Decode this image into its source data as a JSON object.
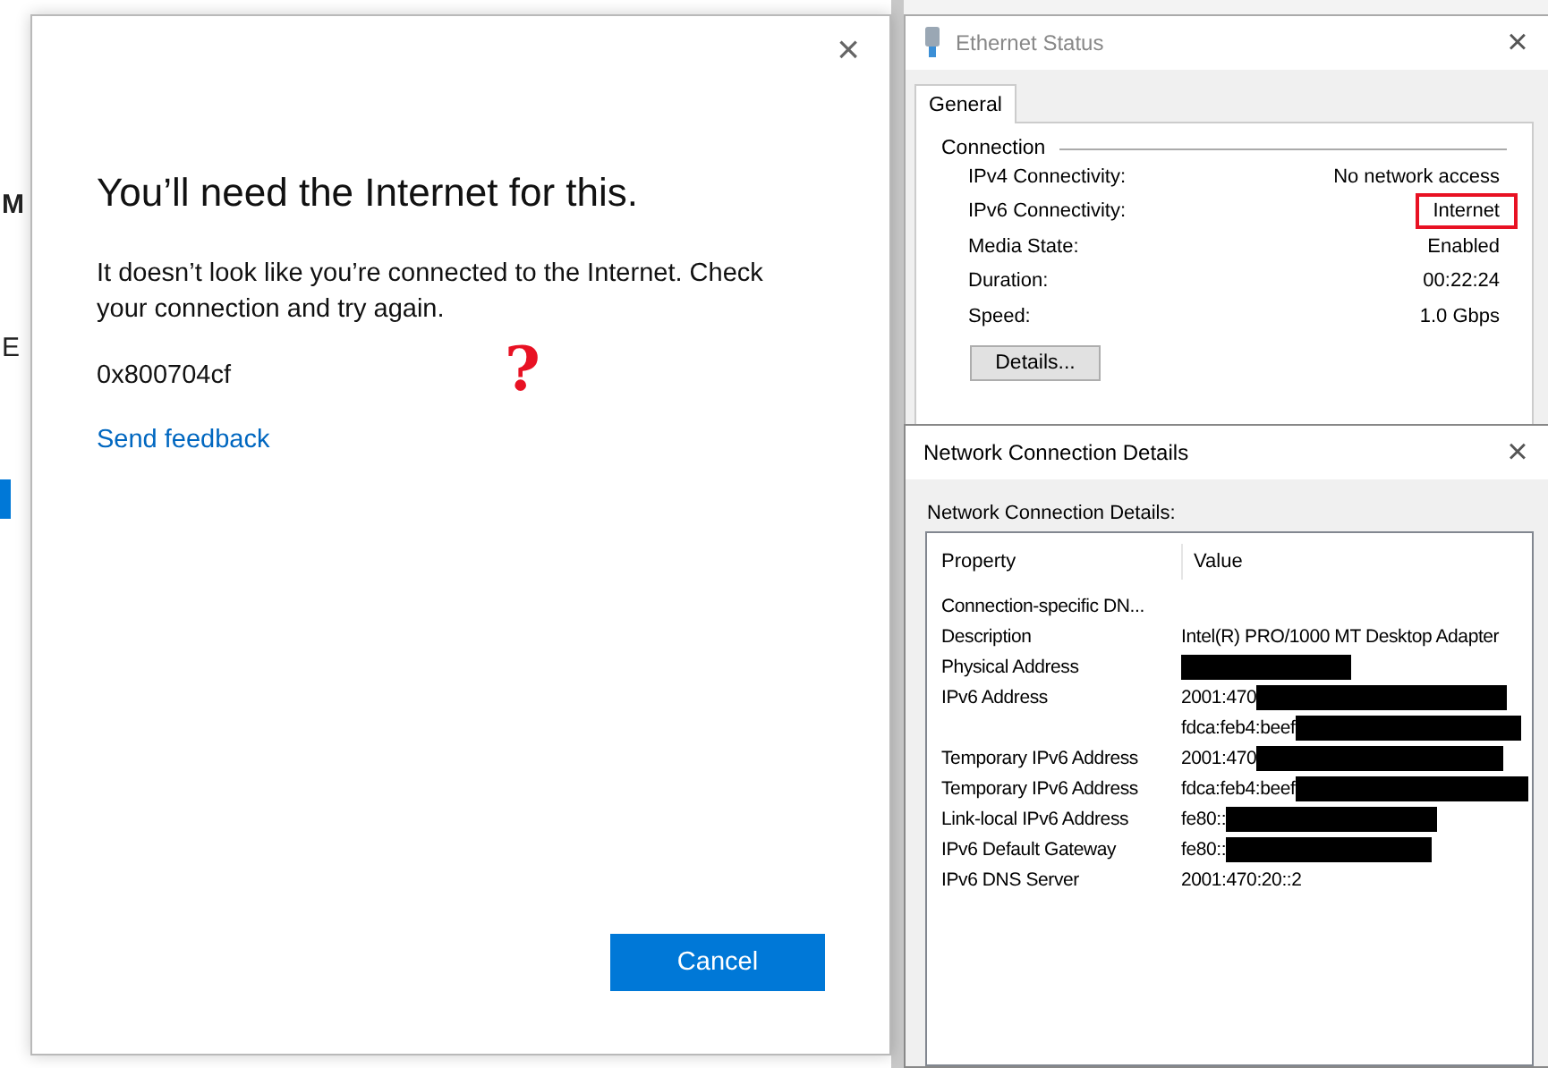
{
  "background_window": {
    "fragments": [
      "M",
      "E"
    ],
    "selected_item_marker": true
  },
  "internet_dialog": {
    "close": "×",
    "title": "You’ll need the Internet for this.",
    "message": "It doesn’t look like you’re connected to the Internet. Check your connection and try again.",
    "error_code": "0x800704cf",
    "link": "Send feedback",
    "annotation": "?",
    "button": "Cancel"
  },
  "ethernet_status": {
    "title": "Ethernet Status",
    "close": "×",
    "tabs": [
      {
        "label": "General",
        "selected": true
      }
    ],
    "group": "Connection",
    "rows": [
      {
        "label": "IPv4 Connectivity:",
        "value": "No network access",
        "highlighted": false
      },
      {
        "label": "IPv6 Connectivity:",
        "value": "Internet",
        "highlighted": true
      },
      {
        "label": "Media State:",
        "value": "Enabled",
        "highlighted": false
      },
      {
        "label": "Duration:",
        "value": "00:22:24",
        "highlighted": false
      },
      {
        "label": "Speed:",
        "value": "1.0 Gbps",
        "highlighted": false
      }
    ],
    "button": "Details..."
  },
  "details_window": {
    "title": "Network Connection Details",
    "close": "×",
    "caption": "Network Connection Details:",
    "columns": [
      "Property",
      "Value"
    ],
    "rows": [
      {
        "property": "Connection-specific DN...",
        "redacted": false
      },
      {
        "property": "Description",
        "value": "Intel(R) PRO/1000 MT Desktop Adapter",
        "redacted": false
      },
      {
        "property": "Physical Address",
        "redacted": true
      },
      {
        "property": "IPv6 Address",
        "value": "2001:470",
        "redacted": true
      },
      {
        "value": "fdca:feb4:beef",
        "redacted": true
      },
      {
        "property": "Temporary IPv6 Address",
        "value": "2001:470",
        "redacted": true
      },
      {
        "property": "Temporary IPv6 Address",
        "value": "fdca:feb4:beef",
        "redacted": true
      },
      {
        "property": "Link-local IPv6 Address",
        "value": "fe80::",
        "redacted": true
      },
      {
        "property": "IPv6 Default Gateway",
        "value": "fe80::",
        "redacted": true
      },
      {
        "property": "IPv6 DNS Server",
        "value": "2001:470:20::2",
        "redacted": false
      }
    ]
  }
}
